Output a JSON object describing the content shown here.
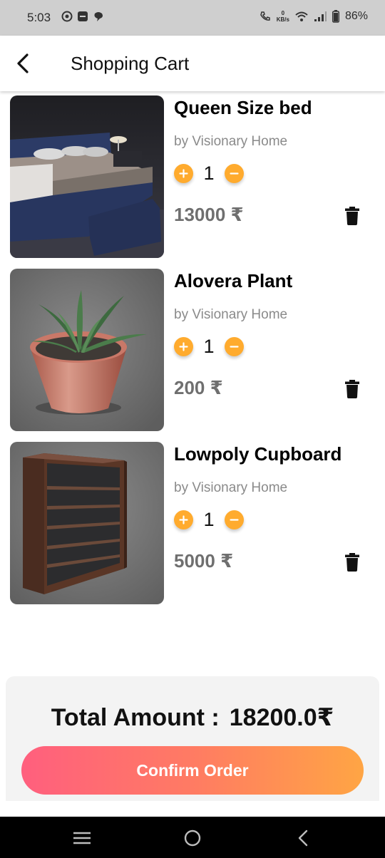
{
  "status_bar": {
    "time": "5:03",
    "network_speed_value": "0",
    "network_speed_unit": "KB/s",
    "battery": "86%"
  },
  "header": {
    "title": "Shopping Cart",
    "back_icon": "chevron-left-icon"
  },
  "cart": {
    "items": [
      {
        "name": "Queen Size bed",
        "seller": "by Visionary Home",
        "quantity": "1",
        "price": "13000 ₹",
        "image": "bed-image"
      },
      {
        "name": "Alovera Plant",
        "seller": "by Visionary Home",
        "quantity": "1",
        "price": "200 ₹",
        "image": "aloe-plant-image"
      },
      {
        "name": "Lowpoly Cupboard",
        "seller": "by Visionary Home",
        "quantity": "1",
        "price": "5000 ₹",
        "image": "cupboard-image"
      }
    ]
  },
  "summary": {
    "total_label": "Total Amount :",
    "total_value": "18200.0₹",
    "confirm_label": "Confirm Order"
  },
  "colors": {
    "accent_orange": "#ffab2e",
    "gradient_start": "#ff5f7e",
    "gradient_end": "#ffa544",
    "price_gray": "#6f6f6f",
    "seller_gray": "#8a8a8a"
  },
  "nav": {
    "icons": [
      "menu-icon",
      "home-circle-icon",
      "back-triangle-icon"
    ]
  }
}
